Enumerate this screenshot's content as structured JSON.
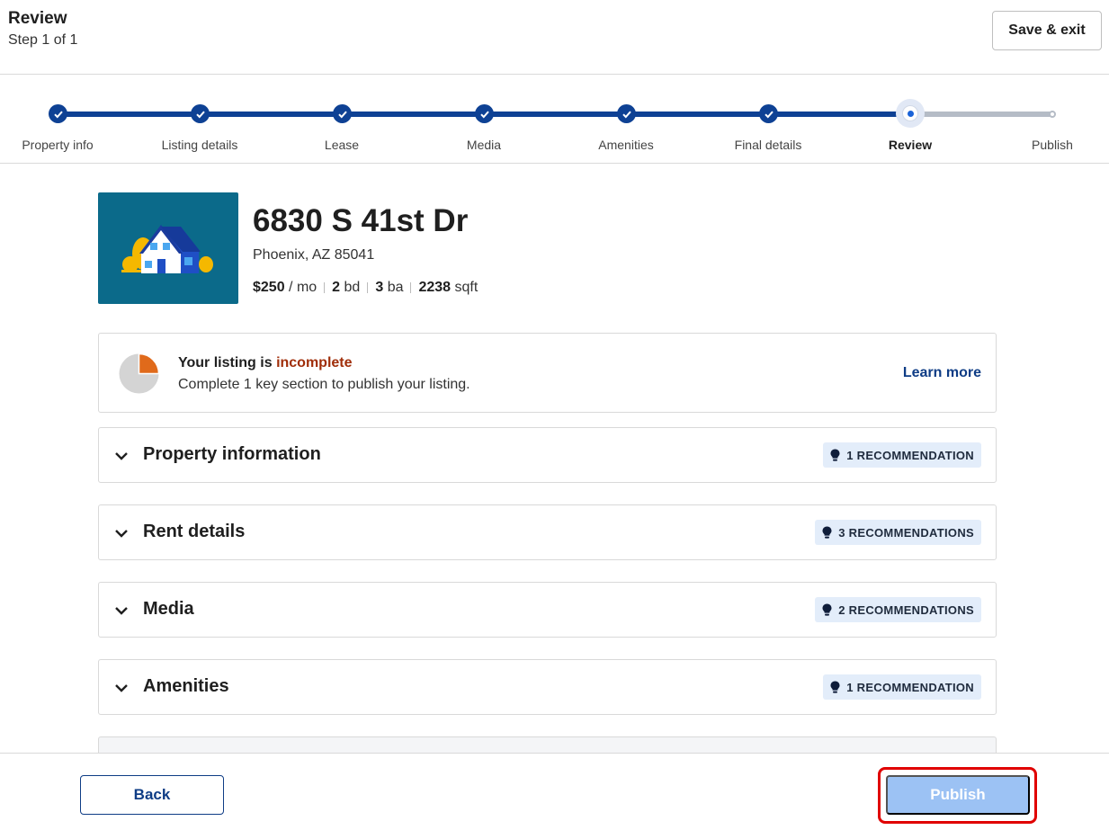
{
  "header": {
    "title": "Review",
    "step": "Step 1 of 1",
    "save_exit_label": "Save & exit"
  },
  "stepper": {
    "steps": [
      {
        "label": "Property info",
        "state": "complete"
      },
      {
        "label": "Listing details",
        "state": "complete"
      },
      {
        "label": "Lease",
        "state": "complete"
      },
      {
        "label": "Media",
        "state": "complete"
      },
      {
        "label": "Amenities",
        "state": "complete"
      },
      {
        "label": "Final details",
        "state": "complete"
      },
      {
        "label": "Review",
        "state": "current"
      },
      {
        "label": "Publish",
        "state": "upcoming"
      }
    ]
  },
  "property": {
    "image_icon": "house-illustration",
    "address": "6830 S 41st Dr",
    "city_line": "Phoenix, AZ 85041",
    "rent": "$250",
    "rent_unit": "/ mo",
    "beds": "2",
    "beds_unit": "bd",
    "baths": "3",
    "baths_unit": "ba",
    "sqft": "2238",
    "sqft_unit": "sqft"
  },
  "status": {
    "title_prefix": "Your listing is",
    "title_status": "incomplete",
    "subtitle": "Complete 1 key section to publish your listing.",
    "learn_more": "Learn more",
    "progress_icon": "pie-progress-icon",
    "completion_fraction": 0.25,
    "accent_color": "#a02e0a"
  },
  "sections": [
    {
      "title": "Property information",
      "badge": "1 RECOMMENDATION"
    },
    {
      "title": "Rent details",
      "badge": "3 RECOMMENDATIONS"
    },
    {
      "title": "Media",
      "badge": "2 RECOMMENDATIONS"
    },
    {
      "title": "Amenities",
      "badge": "1 RECOMMENDATION"
    }
  ],
  "footer": {
    "back_label": "Back",
    "publish_label": "Publish"
  },
  "colors": {
    "primary": "#0e4194",
    "publish_disabled": "#9cc2f4",
    "highlight_ring": "#e00000"
  }
}
